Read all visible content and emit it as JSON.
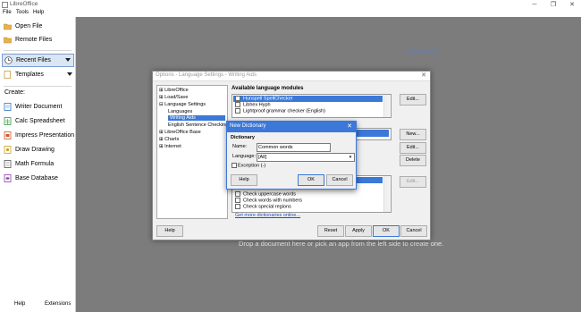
{
  "window": {
    "title": "LibreOffice",
    "minimize": "─",
    "maximize": "❐",
    "close": "✕"
  },
  "menu": [
    "File",
    "Tools",
    "Help"
  ],
  "sidebar": {
    "open_file": "Open File",
    "remote_files": "Remote Files",
    "recent_files": "Recent Files",
    "templates": "Templates",
    "create_label": "Create:",
    "apps": [
      "Writer Document",
      "Calc Spreadsheet",
      "Impress Presentation",
      "Draw Drawing",
      "Math Formula",
      "Base Database"
    ],
    "help": "Help",
    "extensions": "Extensions"
  },
  "start": {
    "drop_text": "Drop a document here or pick an app from the left side to create one."
  },
  "options_dialog": {
    "title": "Options - Language Settings - Writing Aids",
    "tree": [
      "LibreOffice",
      "Load/Save",
      "Language Settings",
      "Languages",
      "Writing Aids",
      "English Sentence Checking",
      "LibreOffice Base",
      "Charts",
      "Internet"
    ],
    "modules_label": "Available language modules",
    "modules": [
      "Hunspell SpellChecker",
      "Libhex Hyph",
      "Lightproof grammar checker (English)"
    ],
    "options_rows": [
      "Check uppercase words",
      "Check words with numbers",
      "Check special regions"
    ],
    "more_link": "Get more dictionaries online...",
    "btn_edit1": "Edit...",
    "btn_new": "New...",
    "btn_edit2": "Edit...",
    "btn_delete": "Delete",
    "btn_edit3": "Edit...",
    "btn_help": "Help",
    "btn_reset": "Reset",
    "btn_apply": "Apply",
    "btn_ok": "OK",
    "btn_cancel": "Cancel"
  },
  "new_dictionary": {
    "title": "New Dictionary",
    "section": "Dictionary",
    "name_label": "Name:",
    "name_value": "Common words",
    "language_label": "Language:",
    "language_value": "[All]",
    "exception_label": "Exception (-)",
    "help": "Help",
    "ok": "OK",
    "cancel": "Cancel"
  },
  "colors": {
    "accent": "#3b78d8",
    "start_bg": "#7c7c7c"
  }
}
